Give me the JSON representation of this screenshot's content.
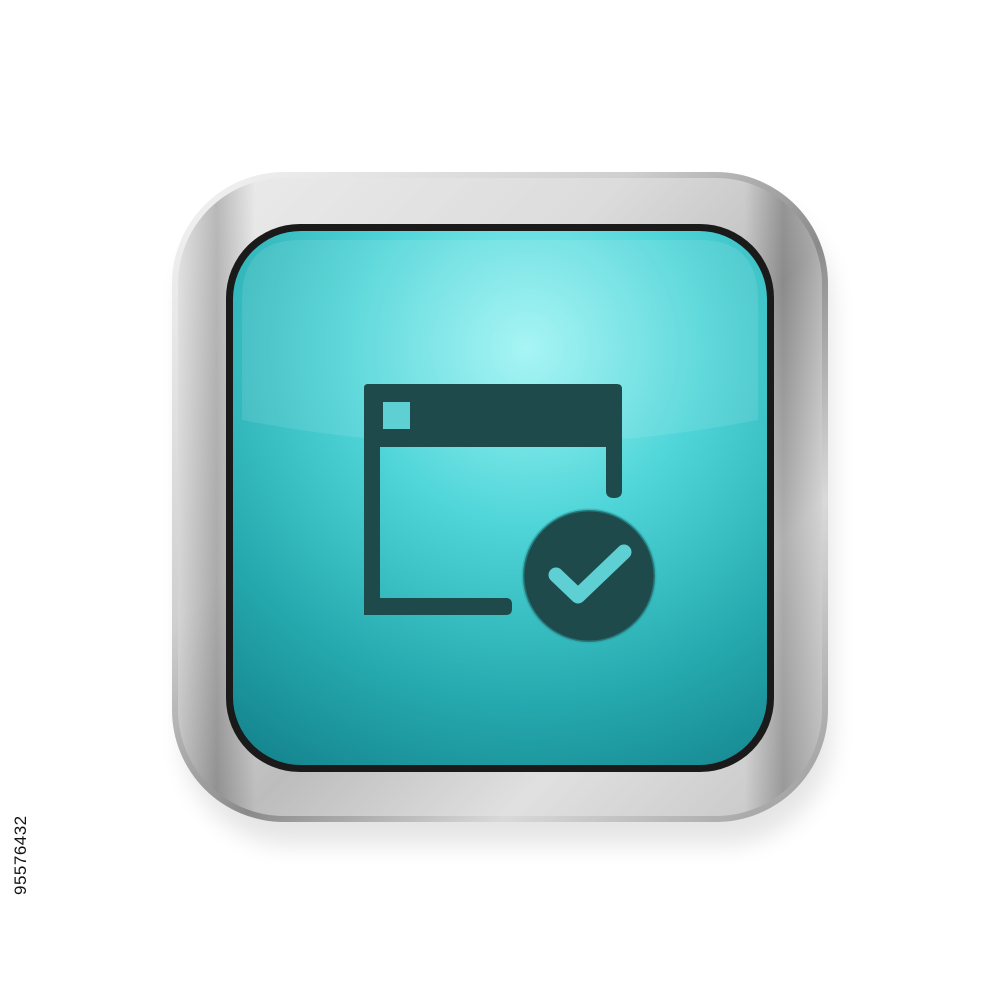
{
  "icon": {
    "name": "window-check-icon",
    "description_visible": false
  },
  "colors": {
    "background": "#ffffff",
    "bezel_light": "#f2f2f2",
    "bezel_mid": "#c4c4c4",
    "bezel_dark": "#7d7d7d",
    "face_highlight": "#93f0f0",
    "face_mid": "#3fc8cc",
    "face_dark": "#168b92",
    "glyph": "#1d4748"
  },
  "watermark": {
    "stock_id": "95576432"
  }
}
